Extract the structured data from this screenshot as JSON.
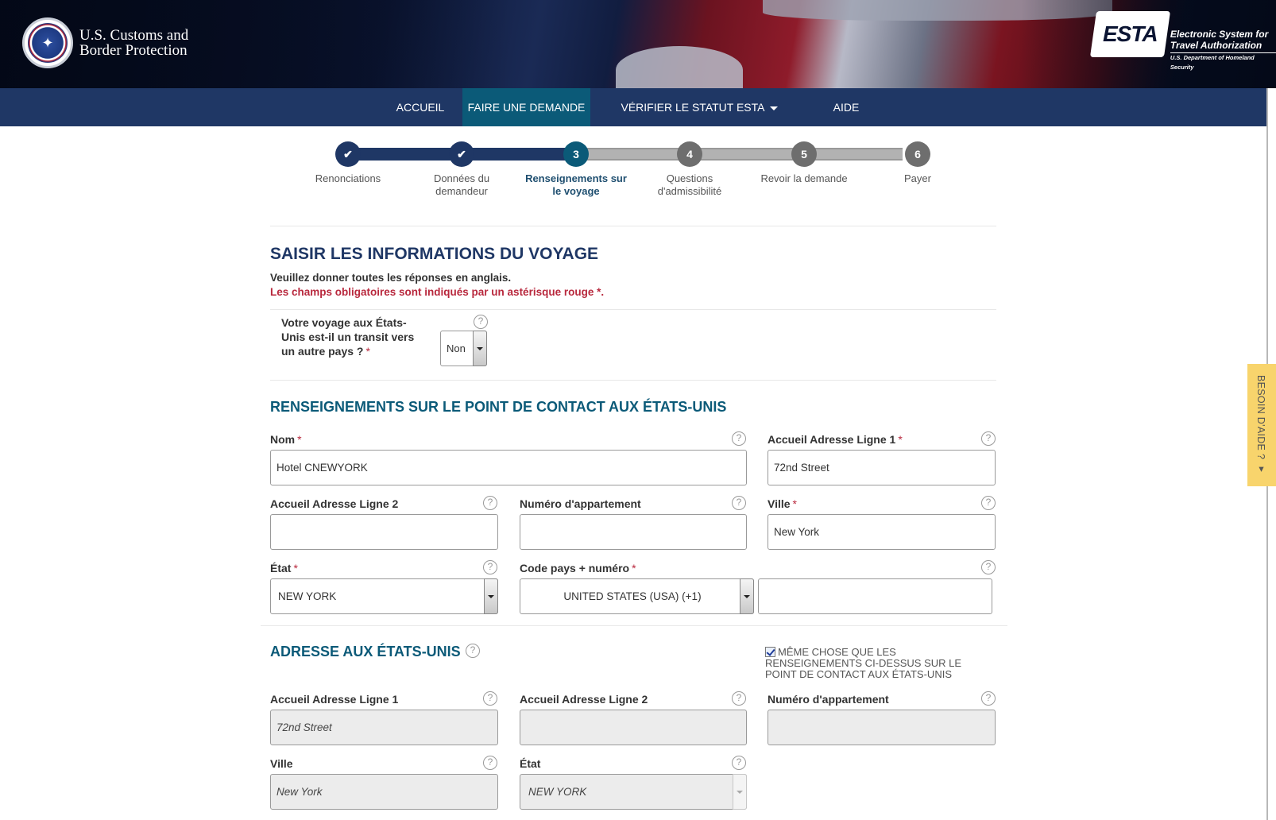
{
  "header": {
    "agency_line1": "U.S. Customs and",
    "agency_line2": "Border Protection",
    "esta_word": "ESTA",
    "esta_line1": "Electronic System for",
    "esta_line2": "Travel Authorization",
    "esta_dept": "U.S. Department of Homeland Security"
  },
  "nav": {
    "items": [
      {
        "label": "ACCUEIL",
        "active": false,
        "dropdown": false
      },
      {
        "label": "FAIRE UNE DEMANDE",
        "active": true,
        "dropdown": true
      },
      {
        "label": "VÉRIFIER LE STATUT ESTA",
        "active": false,
        "dropdown": true
      },
      {
        "label": "AIDE",
        "active": false,
        "dropdown": false
      }
    ]
  },
  "stepper": {
    "current": 3,
    "steps": [
      {
        "num": "✔",
        "label": "Renonciations",
        "state": "done"
      },
      {
        "num": "✔",
        "label": "Données du demandeur",
        "state": "done"
      },
      {
        "num": "3",
        "label": "Renseignements sur le voyage",
        "state": "current"
      },
      {
        "num": "4",
        "label": "Questions d'admissibilité",
        "state": "todo"
      },
      {
        "num": "5",
        "label": "Revoir la demande",
        "state": "todo"
      },
      {
        "num": "6",
        "label": "Payer",
        "state": "todo"
      }
    ]
  },
  "page": {
    "title": "SAISIR LES INFORMATIONS DU VOYAGE",
    "note": "Veuillez donner toutes les réponses en anglais.",
    "required_note": "Les champs obligatoires sont indiqués par un astérisque rouge *.",
    "required_mark": "*",
    "help_glyph": "?"
  },
  "transit": {
    "label": "Votre voyage aux États-Unis est-il un transit vers un autre pays ?",
    "value": "Non"
  },
  "contact": {
    "title": "RENSEIGNEMENTS SUR LE POINT DE CONTACT AUX ÉTATS-UNIS",
    "name_label": "Nom",
    "name_value": "Hotel CNEWYORK",
    "addr1_label": "Accueil Adresse Ligne 1",
    "addr1_value": "72nd Street",
    "addr2_label": "Accueil Adresse Ligne 2",
    "addr2_value": "",
    "apt_label": "Numéro d'appartement",
    "apt_value": "",
    "city_label": "Ville",
    "city_value": "New York",
    "state_label": "État",
    "state_value": "NEW YORK",
    "phone_label": "Code pays + numéro",
    "phone_country": "UNITED STATES (USA) (+1)",
    "phone_number": ""
  },
  "us_address": {
    "title": "ADRESSE AUX ÉTATS-UNIS",
    "same_as_checkbox": "MÊME CHOSE QUE LES RENSEIGNEMENTS CI-DESSUS SUR LE POINT DE CONTACT AUX ÉTATS-UNIS",
    "same_as_checked": true,
    "addr1_label": "Accueil Adresse Ligne 1",
    "addr1_value": "72nd Street",
    "addr2_label": "Accueil Adresse Ligne 2",
    "addr2_value": "",
    "apt_label": "Numéro d'appartement",
    "apt_value": "",
    "city_label": "Ville",
    "city_value": "New York",
    "state_label": "État",
    "state_value": "NEW YORK"
  },
  "help_tab": {
    "label": "BESOIN D'AIDE ? ▾"
  }
}
